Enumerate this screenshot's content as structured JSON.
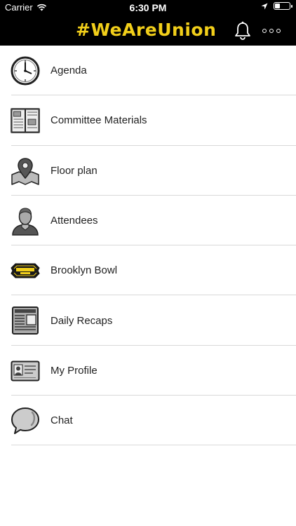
{
  "status_bar": {
    "carrier": "Carrier",
    "time": "6:30 PM"
  },
  "header": {
    "brand": "#WeAreUnion",
    "brand_color": "#f2cf1a",
    "background": "#000000"
  },
  "menu": {
    "items": [
      {
        "label": "Agenda",
        "icon": "clock-icon"
      },
      {
        "label": "Committee Materials",
        "icon": "open-book-icon"
      },
      {
        "label": "Floor plan",
        "icon": "map-pin-icon"
      },
      {
        "label": "Attendees",
        "icon": "person-icon"
      },
      {
        "label": "Brooklyn Bowl",
        "icon": "brooklyn-bowl-logo-icon"
      },
      {
        "label": "Daily Recaps",
        "icon": "newspaper-icon"
      },
      {
        "label": "My Profile",
        "icon": "id-card-icon"
      },
      {
        "label": "Chat",
        "icon": "speech-bubble-icon"
      }
    ]
  }
}
